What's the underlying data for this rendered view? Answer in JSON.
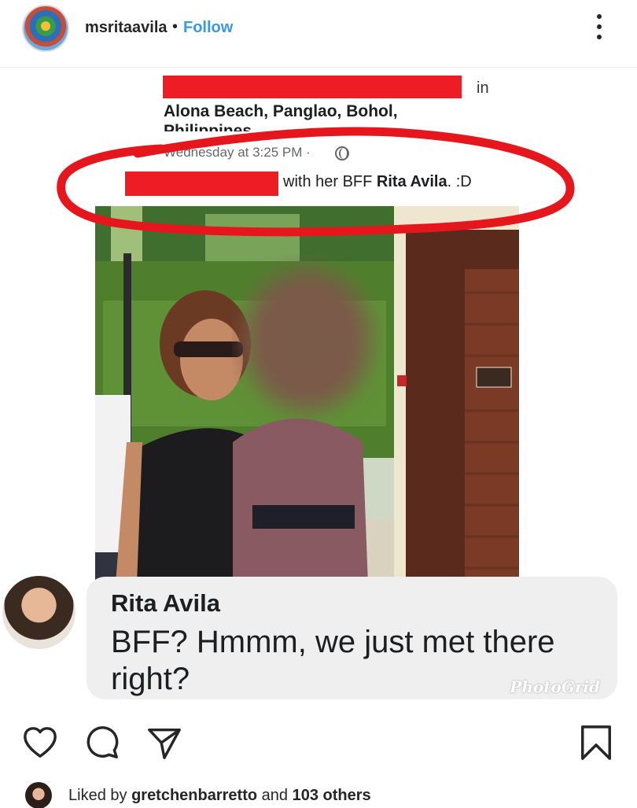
{
  "header": {
    "username": "msritaavila",
    "separator": "•",
    "follow_label": "Follow"
  },
  "fb_post": {
    "in_text": "in",
    "location_line1": "Alona Beach, Panglao, Bohol,",
    "location_line2": "Philippines",
    "timestamp": "Wednesday at 3:25 PM ·",
    "caption_prefix": "with her BFF ",
    "caption_name": "Rita Avila",
    "caption_suffix": ". :D"
  },
  "comment": {
    "author": "Rita Avila",
    "text": "BFF? Hmmm, we just met there right?",
    "watermark": "PhotoGrid"
  },
  "likes": {
    "prefix": "Liked by ",
    "user": "gretchenbarretto",
    "middle": " and ",
    "others": "103 others"
  },
  "colors": {
    "follow": "#3897f0",
    "redaction": "#ee1c25",
    "annotation_circle": "#e5171d",
    "bubble": "#efefef"
  },
  "icons": [
    "more-vertical-icon",
    "heart-icon",
    "comment-icon",
    "share-icon",
    "bookmark-icon",
    "globe-icon"
  ]
}
